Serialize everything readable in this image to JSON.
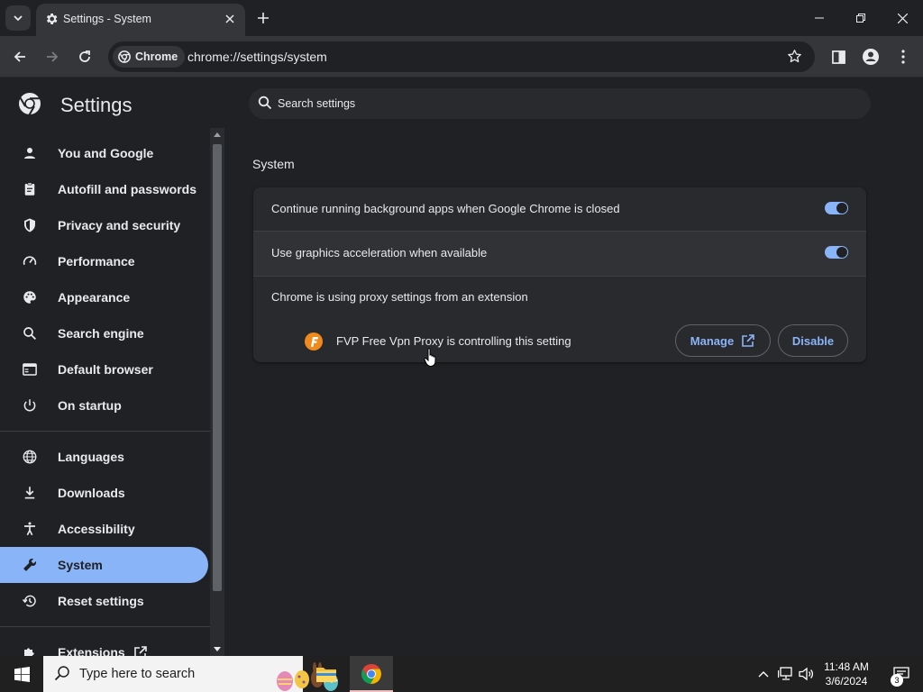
{
  "browser": {
    "tab_title": "Settings - System",
    "chip_label": "Chrome",
    "url": "chrome://settings/system"
  },
  "settings": {
    "title": "Settings",
    "search_placeholder": "Search settings",
    "nav": [
      {
        "label": "You and Google",
        "icon": "person-icon"
      },
      {
        "label": "Autofill and passwords",
        "icon": "clipboard-icon"
      },
      {
        "label": "Privacy and security",
        "icon": "shield-icon"
      },
      {
        "label": "Performance",
        "icon": "speedometer-icon"
      },
      {
        "label": "Appearance",
        "icon": "palette-icon"
      },
      {
        "label": "Search engine",
        "icon": "search-icon"
      },
      {
        "label": "Default browser",
        "icon": "browser-window-icon"
      },
      {
        "label": "On startup",
        "icon": "power-icon"
      },
      {
        "label": "Languages",
        "icon": "globe-icon"
      },
      {
        "label": "Downloads",
        "icon": "download-icon"
      },
      {
        "label": "Accessibility",
        "icon": "accessibility-icon"
      },
      {
        "label": "System",
        "icon": "wrench-icon"
      },
      {
        "label": "Reset settings",
        "icon": "history-icon"
      },
      {
        "label": "Extensions",
        "icon": "puzzle-icon"
      }
    ],
    "active_item": "System",
    "section_title": "System",
    "rows": [
      {
        "label": "Continue running background apps when Google Chrome is closed",
        "enabled": true
      },
      {
        "label": "Use graphics acceleration when available",
        "enabled": true
      },
      {
        "label": "Chrome is using proxy settings from an extension"
      }
    ],
    "extension_notice": "FVP Free Vpn Proxy is controlling this setting",
    "manage_label": "Manage",
    "disable_label": "Disable"
  },
  "taskbar": {
    "search_placeholder": "Type here to search",
    "time": "11:48 AM",
    "date": "3/6/2024",
    "notification_count": "3"
  },
  "colors": {
    "accent": "#8ab4f8",
    "background": "#202124",
    "card": "#292a2d"
  }
}
